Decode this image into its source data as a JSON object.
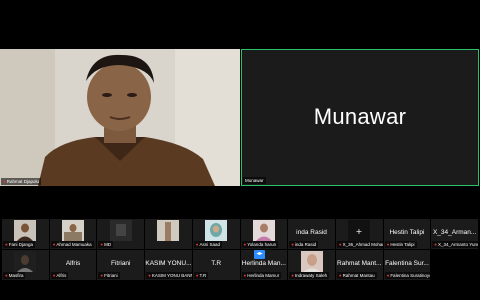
{
  "main": {
    "speaker_tag": "Rahmat Djapolu",
    "active_name": "Munawar",
    "active_tag": "Munawar"
  },
  "gallery": {
    "row1": [
      {
        "tag": "Fani Djanga",
        "title": "",
        "video": "person"
      },
      {
        "tag": "Ahmad Mamuaka",
        "title": "",
        "video": "room"
      },
      {
        "tag": "MD",
        "title": "",
        "video": "dark"
      },
      {
        "tag": "",
        "title": "",
        "video": "arm"
      },
      {
        "tag": "Asni Saad",
        "title": "",
        "video": "veil"
      },
      {
        "tag": "Yolanda harun",
        "title": "",
        "video": "person-pink"
      },
      {
        "tag": "inda Rasid",
        "title": "inda Rasid",
        "video": "none"
      },
      {
        "tag": "X_36_Ahmad Mohamad",
        "title": "",
        "video": "plus"
      },
      {
        "tag": "Hestin Talipi",
        "title": "Hestin Talipi",
        "video": "none"
      },
      {
        "tag": "X_34_Armanto Yunus",
        "title": "X_34_Arman...",
        "video": "none"
      }
    ],
    "row2": [
      {
        "tag": "Masfira",
        "title": "",
        "video": "person-dark"
      },
      {
        "tag": "Alfris",
        "title": "Alfris",
        "video": "none"
      },
      {
        "tag": "Fitriani",
        "title": "Fitriani",
        "video": "none"
      },
      {
        "tag": "KASIM YONU BANNS...",
        "title": "KASIM YONU...",
        "video": "none"
      },
      {
        "tag": "T.R",
        "title": "T.R",
        "video": "none"
      },
      {
        "tag": "Herlinda Mamur",
        "title": "Herlinda Man...",
        "video": "none"
      },
      {
        "tag": "Indrawaty Saleh",
        "title": "",
        "video": "woman"
      },
      {
        "tag": "Rahmat Mantau",
        "title": "Rahmat Mant...",
        "video": "none"
      },
      {
        "tag": "Falentina Suratinoyo",
        "title": "Falentina Sur...",
        "video": "none"
      }
    ]
  },
  "controls": {
    "page_arrow": "◂▸"
  },
  "colors": {
    "active_border": "#27c36b",
    "tile_bg": "#1b1b1b",
    "mic_muted": "#e0352b",
    "accent": "#2d8cff"
  }
}
